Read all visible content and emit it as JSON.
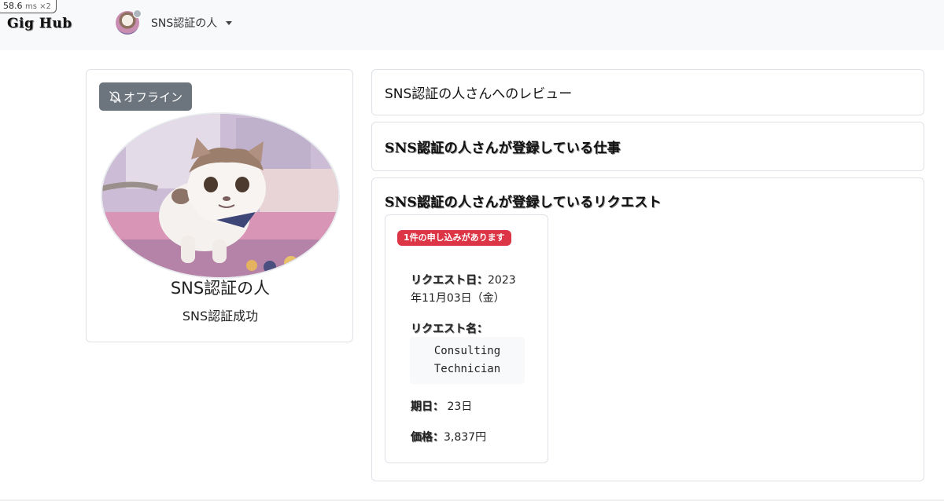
{
  "perf": {
    "value": "58.6",
    "unit": "ms ×2"
  },
  "navbar": {
    "brand": "Gig Hub",
    "user_name": "SNS認証の人"
  },
  "profile": {
    "status_label": "オフライン",
    "name": "SNS認証の人",
    "subtitle": "SNS認証成功"
  },
  "sections": {
    "reviews_title": "SNS認証の人さんへのレビュー",
    "jobs_title": "SNS認証の人さんが登録している仕事",
    "requests_title": "SNS認証の人さんが登録しているリクエスト"
  },
  "request": {
    "badge": "1件の申し込みがあります",
    "date_label": "リクエスト日：",
    "date_value_a": "2023",
    "date_value_b": "年11月03日（金）",
    "name_label": "リクエスト名：",
    "name_line1": "Consulting",
    "name_line2": "Technician",
    "deadline_label": "期日：",
    "deadline_value": " 23日",
    "price_label": "価格：",
    "price_value": "3,837円"
  }
}
